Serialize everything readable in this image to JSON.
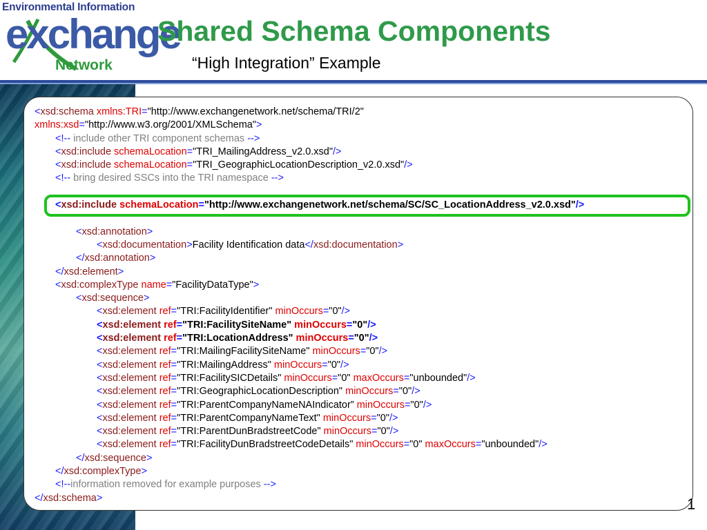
{
  "logo": {
    "line1": "Environmental Information",
    "line2": "exchange",
    "line3": "Network"
  },
  "slide": {
    "title": "Shared Schema Components",
    "subtitle": "“High Integration” Example",
    "page_number": "1"
  },
  "colors": {
    "title": "#2f9a4a",
    "tag": "#1a1aff",
    "element_name": "#8b1a1a",
    "attribute": "#e00000",
    "comment": "#808080",
    "highlight": "#1ec21e"
  },
  "code": {
    "l1": {
      "open": "<",
      "tag": "xsd:schema",
      "attr": "xmlns:TRI",
      "eq": "=",
      "val": "\"http://www.exchangenetwork.net/schema/TRI/2\""
    },
    "l2": {
      "attr": "xmlns:xsd",
      "eq": "=",
      "val": "\"http://www.w3.org/2001/XMLSchema\"",
      "close": ">"
    },
    "l3": {
      "open": "<!--",
      "text": " include other TRI component schemas ",
      "close": "-->"
    },
    "l4": {
      "open": "<",
      "tag": "xsd:include",
      "attr": "schemaLocation",
      "eq": "=",
      "val": "\"TRI_MailingAddress_v2.0.xsd\"",
      "close": "/>"
    },
    "l5": {
      "open": "<",
      "tag": "xsd:include",
      "attr": "schemaLocation",
      "eq": "=",
      "val": "\"TRI_GeographicLocationDescription_v2.0.xsd\"",
      "close": "/>"
    },
    "l6": {
      "open": "<!--",
      "text": " bring desired SSCs into the TRI namespace ",
      "close": "-->"
    },
    "l8": {
      "open": "<",
      "tag": "xsd:include",
      "attr": "schemaLocation",
      "eq": "=",
      "val": "\"http://www.exchangenetwork.net/schema/SC/SC_LocationAddress_v2.0.xsd\"",
      "close": "/>"
    },
    "l10": {
      "open": "<",
      "tag": "xsd:annotation",
      "close": ">"
    },
    "l11": {
      "open": "<",
      "tag": "xsd:documentation",
      "close": ">",
      "text": "Facility Identification data",
      "open2": "</",
      "tag2": "xsd:documentation",
      "close2": ">"
    },
    "l12": {
      "open": "</",
      "tag": "xsd:annotation",
      "close": ">"
    },
    "l13": {
      "open": "</",
      "tag": "xsd:element",
      "close": ">"
    },
    "l14": {
      "open": "<",
      "tag": "xsd:complexType",
      "attr": "name",
      "eq": "=",
      "val": "\"FacilityDataType\"",
      "close": ">"
    },
    "l15": {
      "open": "<",
      "tag": "xsd:sequence",
      "close": ">"
    },
    "elements": [
      {
        "tag": "xsd:element",
        "ref_attr": "ref",
        "ref_val": "\"TRI:FacilityIdentifier\"",
        "min_attr": "minOccurs",
        "min_val": "\"0\""
      },
      {
        "tag": "xsd:element",
        "ref_attr": "ref",
        "ref_val": "\"TRI:FacilitySiteName\"",
        "min_attr": "minOccurs",
        "min_val": "\"0\""
      },
      {
        "tag": "xsd:element",
        "ref_attr": "ref",
        "ref_val": "\"TRI:LocationAddress\"",
        "min_attr": "minOccurs",
        "min_val": "\"0\""
      },
      {
        "tag": "xsd:element",
        "ref_attr": "ref",
        "ref_val": "\"TRI:MailingFacilitySiteName\"",
        "min_attr": "minOccurs",
        "min_val": "\"0\""
      },
      {
        "tag": "xsd:element",
        "ref_attr": "ref",
        "ref_val": "\"TRI:MailingAddress\"",
        "min_attr": "minOccurs",
        "min_val": "\"0\""
      },
      {
        "tag": "xsd:element",
        "ref_attr": "ref",
        "ref_val": "\"TRI:FacilitySICDetails\"",
        "min_attr": "minOccurs",
        "min_val": "\"0\"",
        "max_attr": "maxOccurs",
        "max_val": "\"unbounded\""
      },
      {
        "tag": "xsd:element",
        "ref_attr": "ref",
        "ref_val": "\"TRI:GeographicLocationDescription\"",
        "min_attr": "minOccurs",
        "min_val": "\"0\""
      },
      {
        "tag": "xsd:element",
        "ref_attr": "ref",
        "ref_val": "\"TRI:ParentCompanyNameNAIndicator”",
        "min_attr": "minOccurs",
        "min_val": "\"0\""
      },
      {
        "tag": "xsd:element",
        "ref_attr": "ref",
        "ref_val": "\"TRI:ParentCompanyNameText\"",
        "min_attr": "minOccurs",
        "min_val": "\"0\""
      },
      {
        "tag": "xsd:element",
        "ref_attr": "ref",
        "ref_val": "\"TRI:ParentDunBradstreetCode\"",
        "min_attr": "minOccurs",
        "min_val": "\"0\""
      },
      {
        "tag": "xsd:element",
        "ref_attr": "ref",
        "ref_val": "\"TRI:FacilityDunBradstreetCodeDetails\"",
        "min_attr": "minOccurs",
        "min_val": "\"0\"",
        "max_attr": "maxOccurs",
        "max_val": "\"unbounded\""
      }
    ],
    "l27": {
      "open": "</",
      "tag": "xsd:sequence",
      "close": ">"
    },
    "l28": {
      "open": "</",
      "tag": "xsd:complexType",
      "close": ">"
    },
    "l29": {
      "open": "<!--",
      "text": "information removed for example purposes ",
      "close": "-->"
    },
    "l30": {
      "open": "</",
      "tag": "xsd:schema",
      "close": ">"
    }
  }
}
